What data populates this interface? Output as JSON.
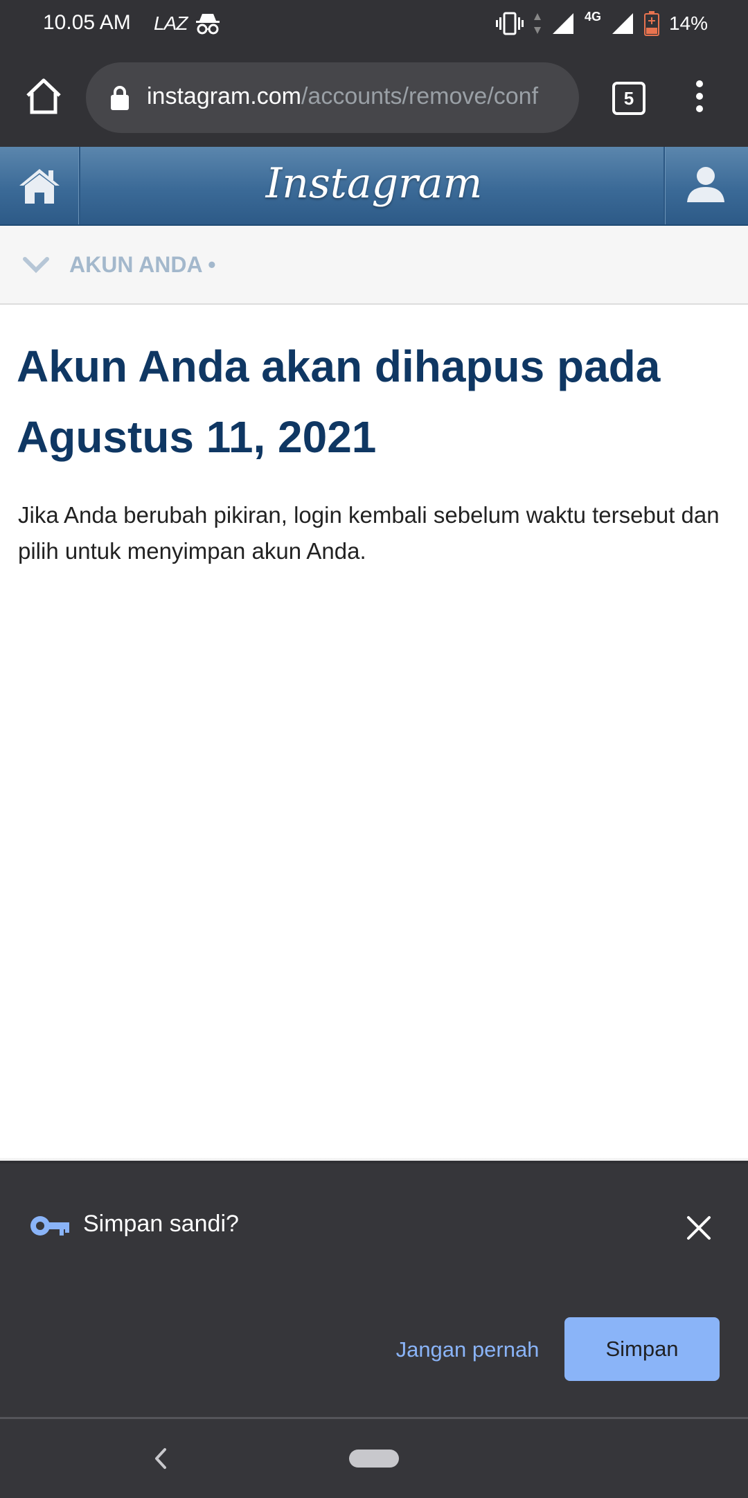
{
  "status_bar": {
    "time": "10.05 AM",
    "carrier_icon_text": "LAZ",
    "network": "4G",
    "battery": "14%",
    "icons": [
      "incognito-icon",
      "vibrate-icon",
      "signal-icon",
      "battery-icon"
    ]
  },
  "browser": {
    "url_host": "instagram.com",
    "url_path": "/accounts/remove/conf",
    "tab_count": "5",
    "icons": [
      "home-icon",
      "lock-icon",
      "tab-switcher-icon",
      "overflow-menu-icon"
    ]
  },
  "instagram": {
    "logo": "Instagram",
    "section_label": "AKUN ANDA •",
    "icons": [
      "home-icon",
      "profile-icon",
      "chevron-down-icon"
    ]
  },
  "content": {
    "headline": "Akun Anda akan dihapus pada Agustus 11, 2021",
    "body": "Jika Anda berubah pikiran, login kembali sebelum waktu tersebut dan pilih untuk menyimpan akun Anda."
  },
  "password_prompt": {
    "title": "Simpan sandi?",
    "never_label": "Jangan pernah",
    "save_label": "Simpan",
    "accent_color": "#8ab4f8"
  },
  "colors": {
    "headline": "#0f3763",
    "ig_header": "#3b6a97",
    "chrome_dark": "#323236"
  }
}
